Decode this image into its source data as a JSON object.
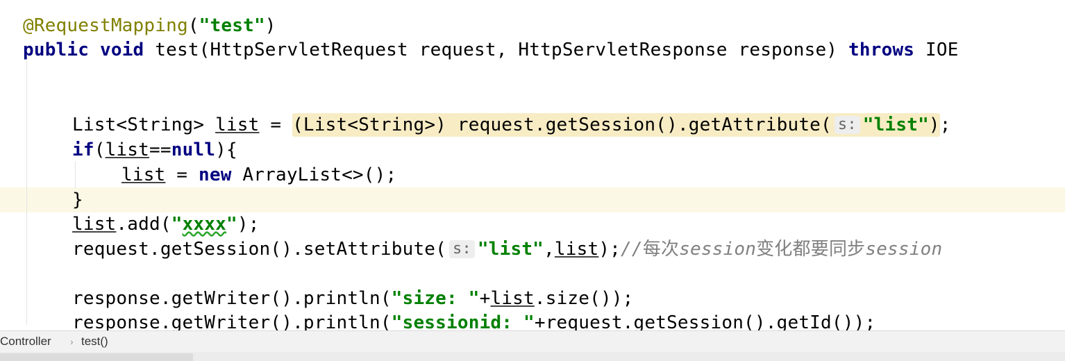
{
  "code": {
    "annotation": "@RequestMapping",
    "mapping_value": "\"test\"",
    "method_sig_public": "public",
    "method_sig_void": "void",
    "method_sig_rest": " test(HttpServletRequest request, HttpServletResponse response) ",
    "method_sig_throws": "throws",
    "method_sig_tail": " IOE",
    "decl_type": "List<String> ",
    "var_list": "list",
    "decl_expr": "(List<String>) request.getSession().getAttribute(",
    "param_hint_s": "s:",
    "str_list": "\"list\"",
    "kw_if": "if",
    "kw_null": "null",
    "kw_new": "new",
    "new_expr": " ArrayList<>();",
    "close_brace": "}",
    "add_call": ".add(",
    "str_xxxx": "xxxx",
    "set_call": "request.getSession().setAttribute(",
    "comment_prefix": "//",
    "comment_cjk_1": "每次",
    "comment_session": "session",
    "comment_cjk_2": "变化都要同步",
    "println_call": "response.getWriter().println(",
    "str_size": "\"size: \"",
    "size_tail": ".size());",
    "str_sessionid": "\"sessionid: \"",
    "sessionid_tail": "+request.getSession().getId());"
  },
  "breadcrumb": {
    "class_name": "Controller",
    "separator": "›",
    "method_name": "test()"
  }
}
